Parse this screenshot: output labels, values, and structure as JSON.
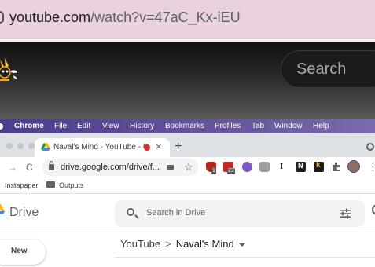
{
  "address_bar": {
    "domain": "youtube.com",
    "path": "/watch?v=47aC_Kx-iEU"
  },
  "youtube": {
    "search_placeholder": "Search"
  },
  "mac_menu": [
    "Chrome",
    "File",
    "Edit",
    "View",
    "History",
    "Bookmarks",
    "Profiles",
    "Tab",
    "Window",
    "Help"
  ],
  "chrome": {
    "tab_title": "Naval's Mind - YouTube - G",
    "tab_close": "×",
    "new_tab": "+",
    "omnibox_url": "drive.google.com/drive/f...",
    "star": "☆",
    "nav_forward": "→",
    "nav_reload": "C",
    "ext_badges": {
      "ext2": "1",
      "ext3": "23"
    },
    "ext_letters": {
      "i": "I",
      "n": "N",
      "k": "k"
    },
    "menu_dots": "⋮"
  },
  "bookmarks": [
    "Instapaper",
    "Outputs"
  ],
  "drive": {
    "app_name": "Drive",
    "search_placeholder": "Search in Drive",
    "new_button": "New",
    "breadcrumbs": [
      "YouTube",
      "Naval's Mind"
    ],
    "breadcrumb_sep": ">"
  },
  "colors": {
    "url_bar_bg": "#e9d1dd",
    "menu_bar": "#5e4a96",
    "rec_dot": "#d93025"
  }
}
